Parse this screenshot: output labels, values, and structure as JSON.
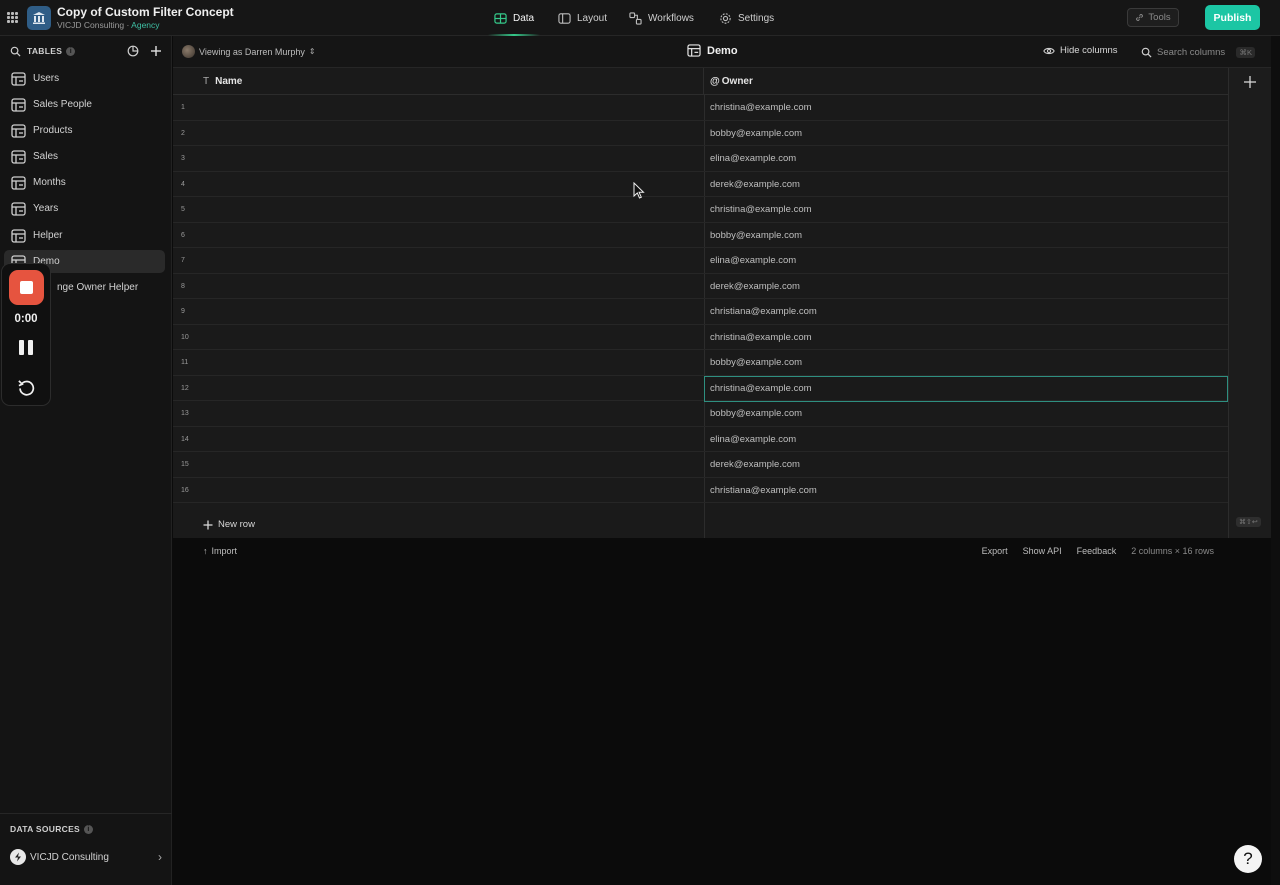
{
  "app": {
    "title": "Copy of Custom Filter Concept",
    "org": "VICJD Consulting · ",
    "tier": "Agency"
  },
  "nav": {
    "data": "Data",
    "layout": "Layout",
    "workflows": "Workflows",
    "settings": "Settings"
  },
  "toolbar": {
    "tools": "Tools",
    "publish": "Publish"
  },
  "sidebar": {
    "tables_label": "TABLES",
    "items": [
      {
        "label": "Users"
      },
      {
        "label": "Sales People"
      },
      {
        "label": "Products"
      },
      {
        "label": "Sales"
      },
      {
        "label": "Months"
      },
      {
        "label": "Years"
      },
      {
        "label": "Helper"
      },
      {
        "label": "Demo"
      },
      {
        "label": "nge Owner Helper"
      }
    ],
    "data_sources_label": "DATA SOURCES",
    "data_source": "VICJD Consulting"
  },
  "recorder": {
    "time": "0:00"
  },
  "header": {
    "viewing_as": "Viewing as Darren Murphy",
    "title": "Demo",
    "hide_columns": "Hide columns",
    "search_placeholder": "Search columns",
    "search_shortcut": "⌘K"
  },
  "table": {
    "columns": [
      "Name",
      "Owner"
    ],
    "rows": [
      {
        "num": "1",
        "owner": "christina@example.com"
      },
      {
        "num": "2",
        "owner": "bobby@example.com"
      },
      {
        "num": "3",
        "owner": "elina@example.com"
      },
      {
        "num": "4",
        "owner": "derek@example.com"
      },
      {
        "num": "5",
        "owner": "christina@example.com"
      },
      {
        "num": "6",
        "owner": "bobby@example.com"
      },
      {
        "num": "7",
        "owner": "elina@example.com"
      },
      {
        "num": "8",
        "owner": "derek@example.com"
      },
      {
        "num": "9",
        "owner": "christiana@example.com"
      },
      {
        "num": "10",
        "owner": "christina@example.com"
      },
      {
        "num": "11",
        "owner": "bobby@example.com"
      },
      {
        "num": "12",
        "owner": "christina@example.com"
      },
      {
        "num": "13",
        "owner": "bobby@example.com"
      },
      {
        "num": "14",
        "owner": "elina@example.com"
      },
      {
        "num": "15",
        "owner": "derek@example.com"
      },
      {
        "num": "16",
        "owner": "christiana@example.com"
      }
    ],
    "selected_row": "12",
    "new_row": "New row",
    "rail_shortcut": "⌘⇧↩"
  },
  "footer": {
    "import": "Import",
    "export": "Export",
    "show_api": "Show API",
    "feedback": "Feedback",
    "count": "2 columns × 16 rows"
  },
  "help": "?",
  "colors": {
    "accent": "#1cc6a4",
    "record": "#e6543f",
    "selection": "#2e8f80"
  }
}
